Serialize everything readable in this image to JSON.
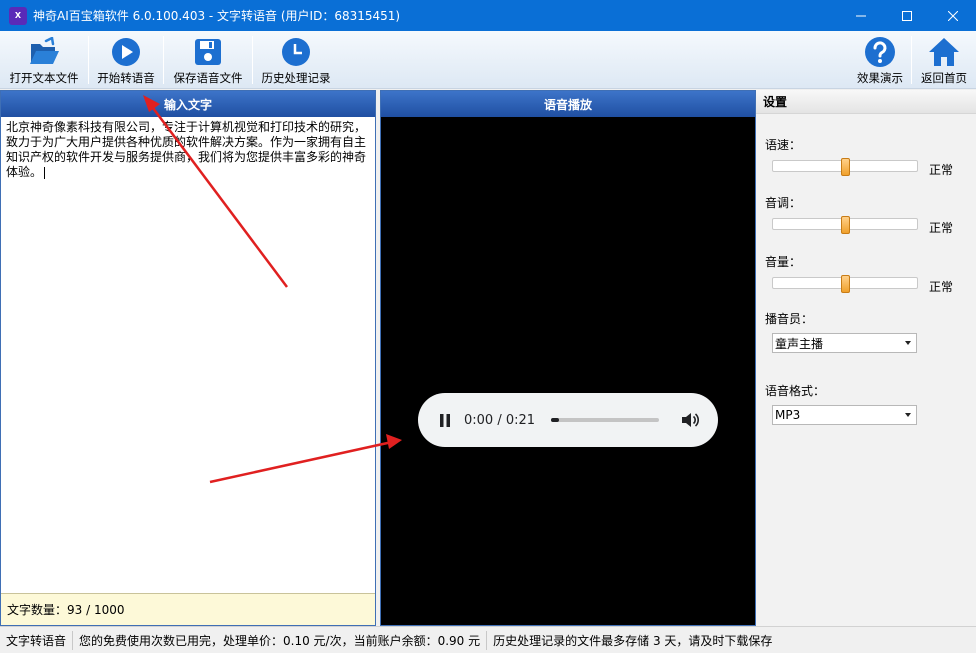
{
  "window": {
    "logo_text": "X",
    "title": "神奇AI百宝箱软件 6.0.100.403 - 文字转语音 (用户ID：68315451)"
  },
  "toolbar": {
    "open_file": "打开文本文件",
    "start_convert": "开始转语音",
    "save_audio": "保存语音文件",
    "history": "历史处理记录",
    "demo": "效果演示",
    "home": "返回首页"
  },
  "input_panel": {
    "title": "输入文字",
    "text": "北京神奇像素科技有限公司，专注于计算机视觉和打印技术的研究，致力于为广大用户提供各种优质的软件解决方案。作为一家拥有自主知识产权的软件开发与服务提供商，我们将为您提供丰富多彩的神奇体验。",
    "count_label": "文字数量：93 / 1000"
  },
  "player_panel": {
    "title": "语音播放",
    "time": "0:00 / 0:21",
    "progress": 0.07
  },
  "settings": {
    "title": "设置",
    "speed_label": "语速：",
    "speed_value": "正常",
    "speed_level": 0.5,
    "pitch_label": "音调：",
    "pitch_value": "正常",
    "pitch_level": 0.5,
    "volume_label": "音量：",
    "volume_value": "正常",
    "volume_level": 0.5,
    "voice_label": "播音员：",
    "voice_selected": "童声主播",
    "format_label": "语音格式：",
    "format_selected": "MP3"
  },
  "status": {
    "module": "文字转语音",
    "pricing": "您的免费使用次数已用完，处理单价：0.10 元/次，当前账户余额：0.90 元",
    "notice": "历史处理记录的文件最多存储 3 天，请及时下载保存"
  },
  "colors": {
    "titlebar": "#0a6fd6",
    "panel_header": "#2a5db0",
    "annotation_arrow": "#e02020"
  }
}
